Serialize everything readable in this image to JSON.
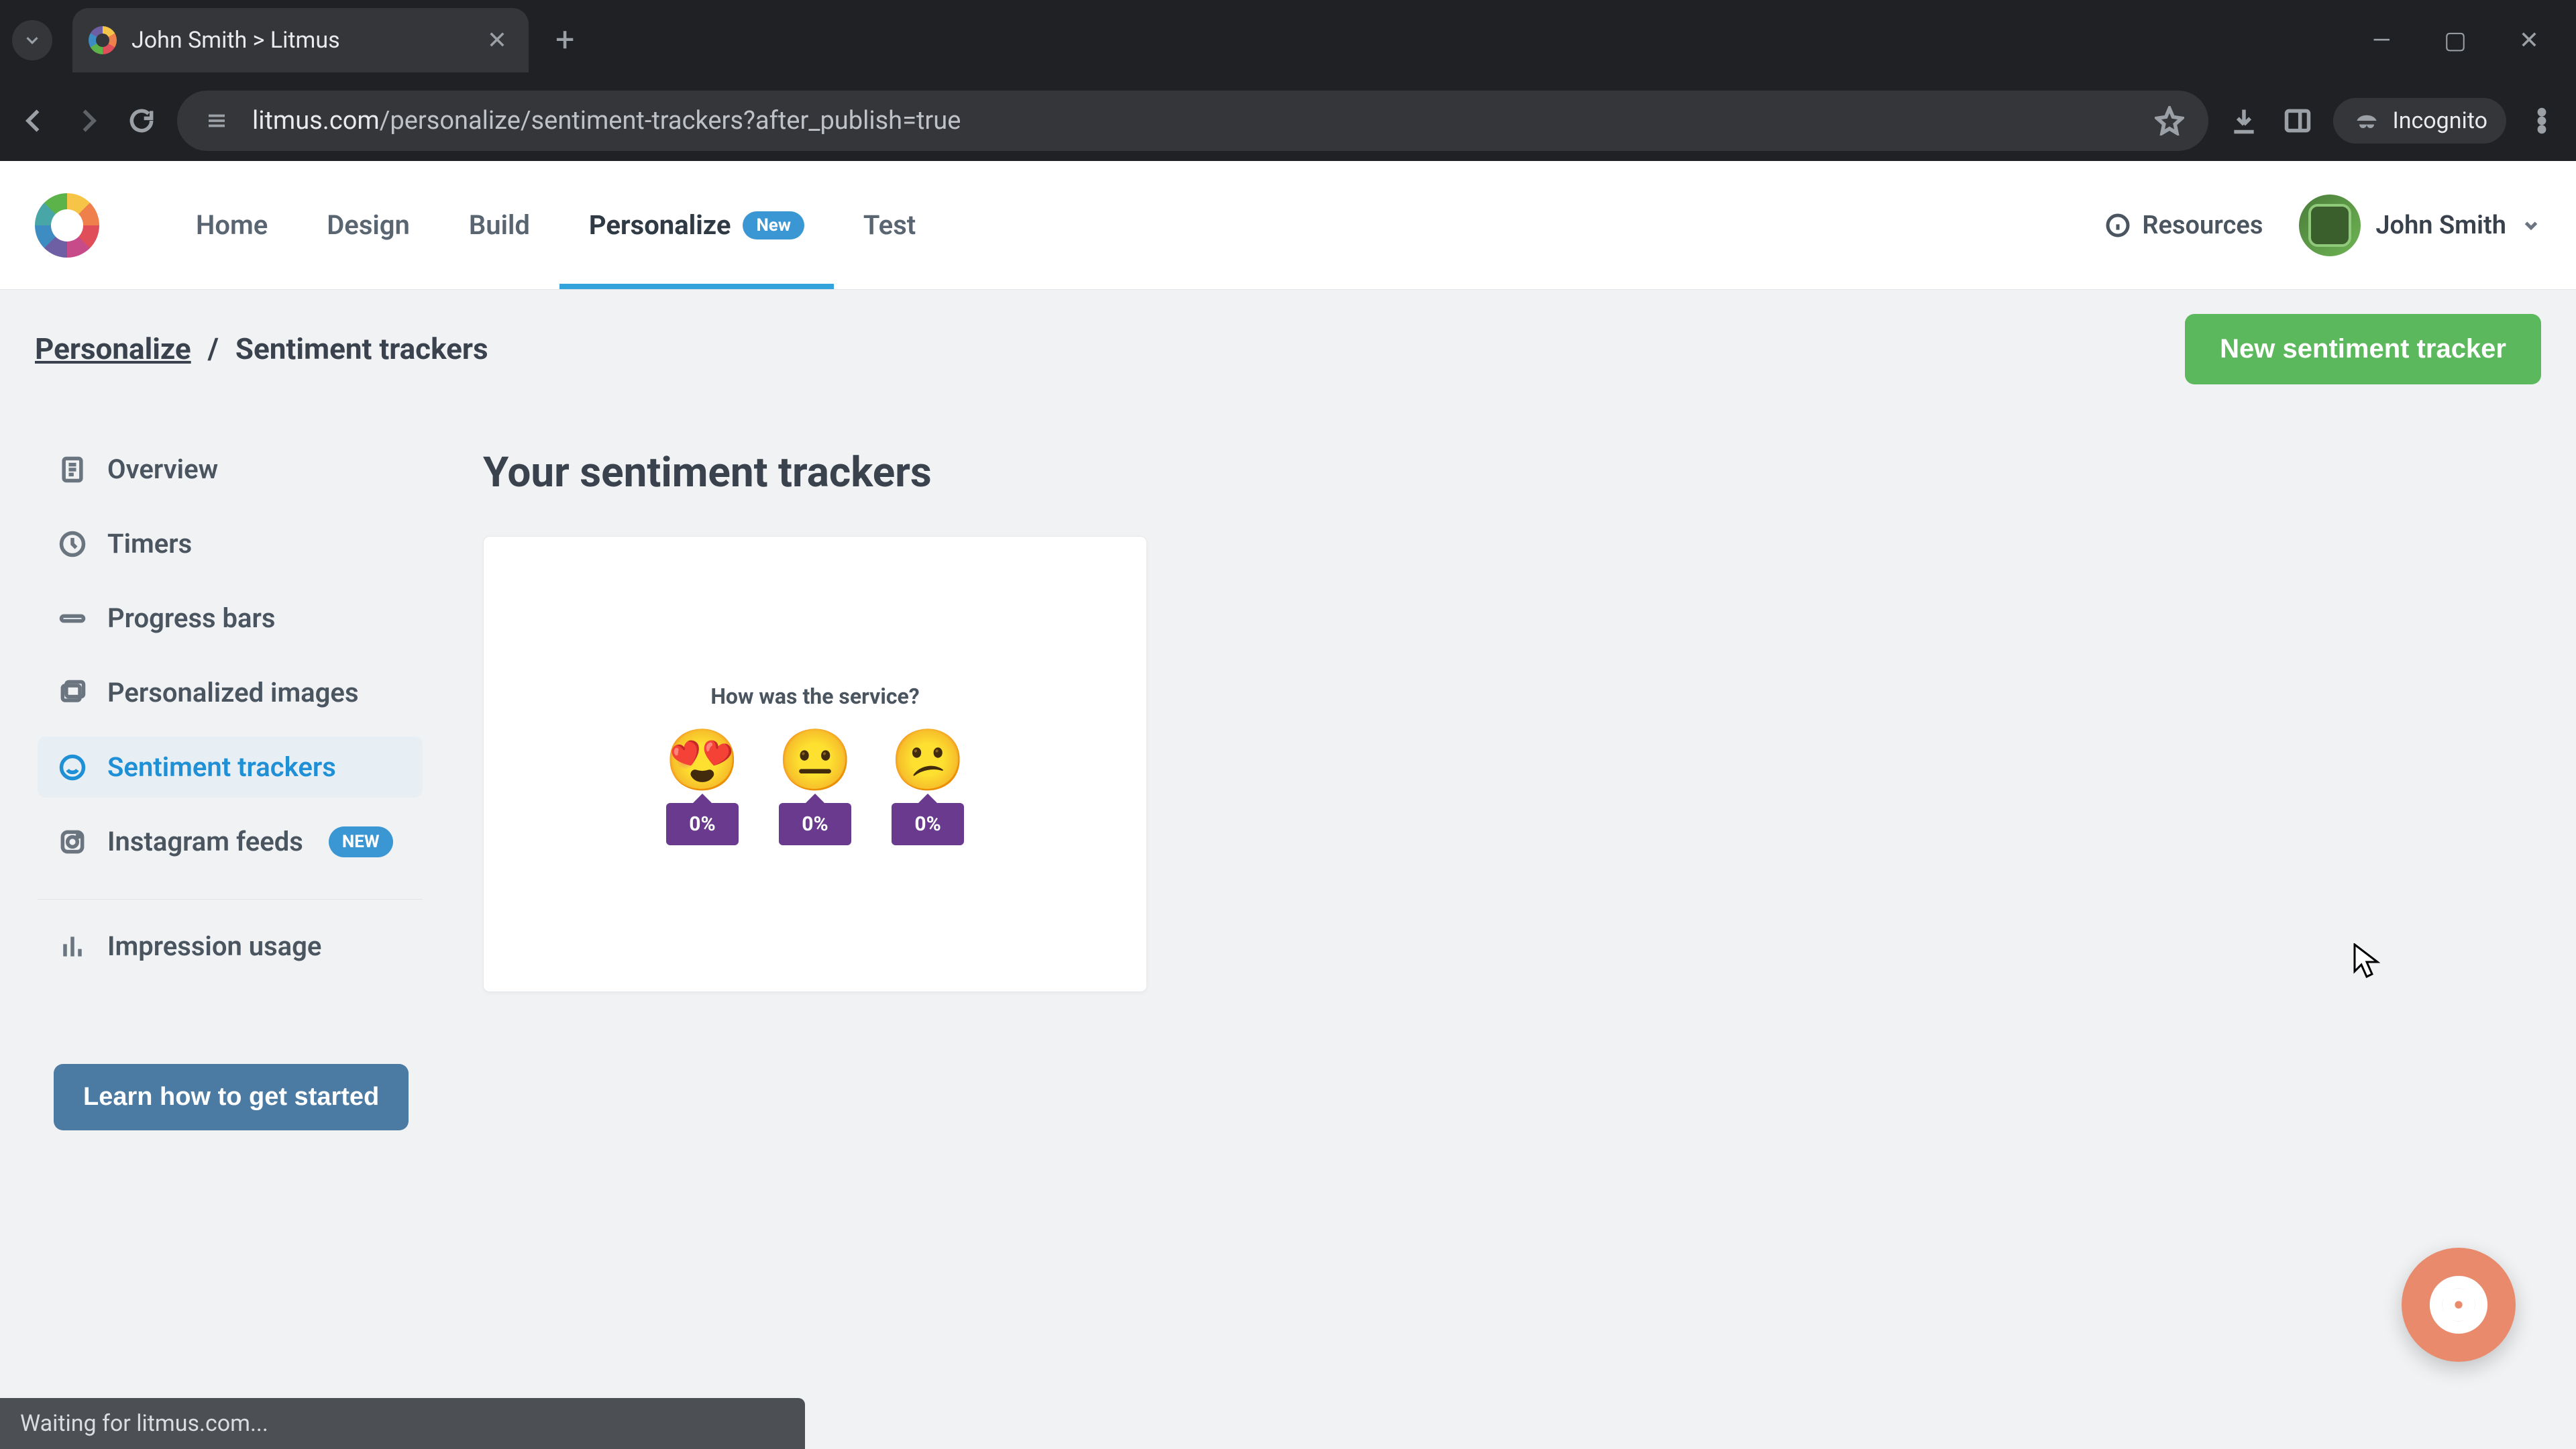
{
  "browser": {
    "tab_title": "John Smith > Litmus",
    "url_host": "litmus.com",
    "url_path": "/personalize/sentiment-trackers?after_publish=true",
    "incognito_label": "Incognito",
    "status_text": "Waiting for litmus.com..."
  },
  "header": {
    "nav": {
      "home": "Home",
      "design": "Design",
      "build": "Build",
      "personalize": "Personalize",
      "personalize_badge": "New",
      "test": "Test"
    },
    "resources": "Resources",
    "user_name": "John Smith"
  },
  "crumb": {
    "root": "Personalize",
    "current": "Sentiment trackers",
    "cta": "New sentiment tracker"
  },
  "sidebar": {
    "items": [
      {
        "label": "Overview"
      },
      {
        "label": "Timers"
      },
      {
        "label": "Progress bars"
      },
      {
        "label": "Personalized images"
      },
      {
        "label": "Sentiment trackers"
      },
      {
        "label": "Instagram feeds",
        "badge": "NEW"
      }
    ],
    "usage": "Impression usage",
    "learn": "Learn how to get started"
  },
  "main": {
    "title": "Your sentiment trackers",
    "card": {
      "question": "How was the service?",
      "emojis": [
        "😍",
        "😐",
        "😕"
      ],
      "pcts": [
        "0%",
        "0%",
        "0%"
      ]
    }
  }
}
